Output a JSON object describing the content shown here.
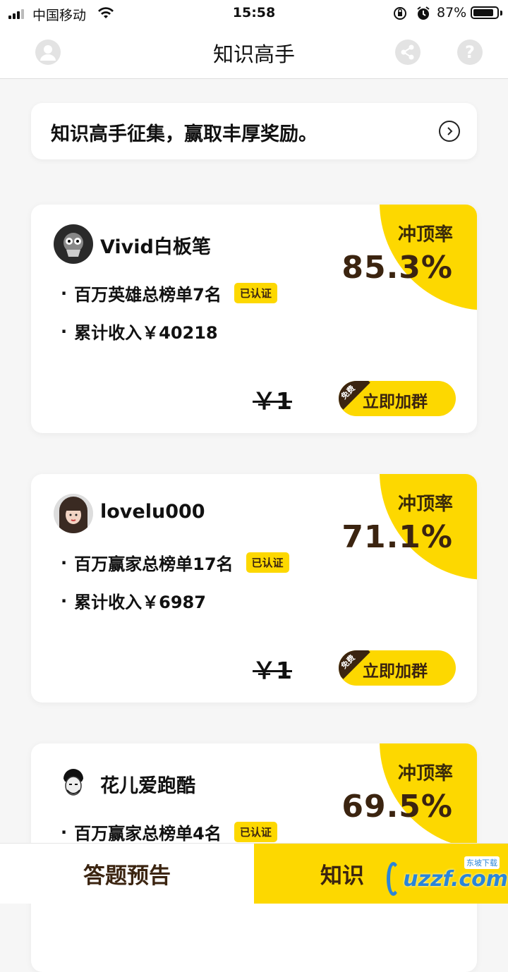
{
  "status_bar": {
    "carrier": "中国移动",
    "time": "15:58",
    "battery": "87%",
    "battery_level": 0.87
  },
  "nav": {
    "title": "知识高手",
    "icons": [
      "avatar-icon",
      "share-icon",
      "help-icon"
    ],
    "help_glyph": "?"
  },
  "banner": {
    "text": "知识高手征集，赢取丰厚奖励。"
  },
  "cards": [
    {
      "name": "Vivid白板笔",
      "rate_label": "冲顶率",
      "rate": "85.3%",
      "rank": "百万英雄总榜单7名",
      "verified": "已认证",
      "income": "累计收入￥40218",
      "price": "￥1",
      "free_badge": "免费",
      "button": "立即加群"
    },
    {
      "name": "lovelu000",
      "rate_label": "冲顶率",
      "rate": "71.1%",
      "rank": "百万赢家总榜单17名",
      "verified": "已认证",
      "income": "累计收入￥6987",
      "price": "￥1",
      "free_badge": "免费",
      "button": "立即加群"
    },
    {
      "name": "花儿爱跑酷",
      "rate_label": "冲顶率",
      "rate": "69.5%",
      "rank": "百万赢家总榜单4名",
      "verified": "已认证"
    }
  ],
  "tabs": {
    "left": "答题预告",
    "right": "知识"
  },
  "watermark": {
    "text": "uzzf.com",
    "sub": "东坡下载"
  },
  "colors": {
    "accent": "#fdd800",
    "dark_brown": "#3b2410",
    "background": "#f6f6f6"
  }
}
